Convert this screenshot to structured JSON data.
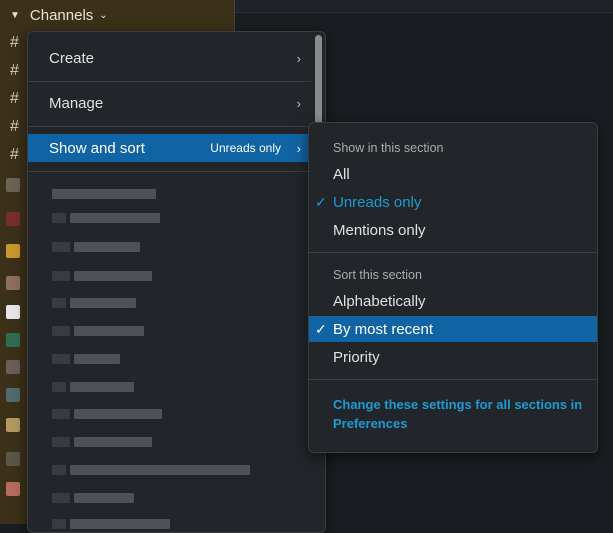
{
  "sidebar": {
    "section_title": "Channels",
    "caret_glyph": "▼",
    "chevron_glyph": "⌄",
    "hash_glyph": "#"
  },
  "menu": {
    "items": [
      {
        "label": "Create",
        "arrow": "›"
      },
      {
        "label": "Manage",
        "arrow": "›"
      },
      {
        "label": "Show and sort",
        "hint": "Unreads only",
        "arrow": "›"
      }
    ]
  },
  "submenu": {
    "show_header": "Show in this section",
    "show_options": [
      "All",
      "Unreads only",
      "Mentions only"
    ],
    "show_selected": "Unreads only",
    "sort_header": "Sort this section",
    "sort_options": [
      "Alphabetically",
      "By most recent",
      "Priority"
    ],
    "sort_selected": "By most recent",
    "check_glyph": "✓",
    "footer_link": "Change these settings for all sections in Preferences"
  },
  "colors": {
    "accent": "#1164a3",
    "link": "#1d9bd1",
    "sidebar_bg": "#3b3018",
    "menu_bg": "#222529"
  }
}
